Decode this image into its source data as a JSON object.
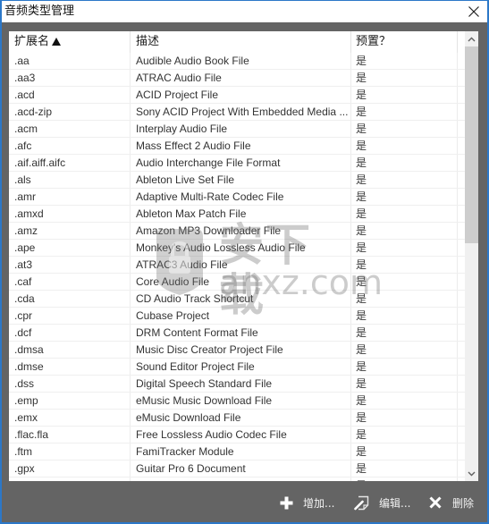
{
  "theme": {
    "accent": "#2c78c8",
    "panel": "#646464",
    "scroll_thumb": "#cdcdcd",
    "scroll_track": "#f0f0f0",
    "toolbar_text": "#f2f2f2"
  },
  "window": {
    "title": "音频类型管理",
    "close_icon": "close-icon"
  },
  "table": {
    "columns": [
      {
        "key": "ext",
        "label": "扩展名",
        "sort": "ascending",
        "sort_icon": "sort-ascending-icon"
      },
      {
        "key": "description",
        "label": "描述"
      },
      {
        "key": "preset",
        "label": "预置？"
      }
    ],
    "rows": [
      {
        "ext": ".aa",
        "description": "Audible Audio Book File",
        "preset": "是"
      },
      {
        "ext": ".aa3",
        "description": "ATRAC Audio File",
        "preset": "是"
      },
      {
        "ext": ".acd",
        "description": "ACID Project File",
        "preset": "是"
      },
      {
        "ext": ".acd-zip",
        "description": "Sony ACID Project With Embedded Media ...",
        "preset": "是"
      },
      {
        "ext": ".acm",
        "description": "Interplay Audio File",
        "preset": "是"
      },
      {
        "ext": ".afc",
        "description": "Mass Effect 2 Audio File",
        "preset": "是"
      },
      {
        "ext": ".aif.aiff.aifc",
        "description": "Audio Interchange File Format",
        "preset": "是"
      },
      {
        "ext": ".als",
        "description": "Ableton Live Set File",
        "preset": "是"
      },
      {
        "ext": ".amr",
        "description": "Adaptive Multi-Rate Codec File",
        "preset": "是"
      },
      {
        "ext": ".amxd",
        "description": "Ableton Max Patch File",
        "preset": "是"
      },
      {
        "ext": ".amz",
        "description": "Amazon MP3 Downloader File",
        "preset": "是"
      },
      {
        "ext": ".ape",
        "description": "Monkey's Audio Lossless Audio File",
        "preset": "是"
      },
      {
        "ext": ".at3",
        "description": "ATRAC3 Audio File",
        "preset": "是"
      },
      {
        "ext": ".caf",
        "description": "Core Audio File",
        "preset": "是"
      },
      {
        "ext": ".cda",
        "description": "CD Audio Track Shortcut",
        "preset": "是"
      },
      {
        "ext": ".cpr",
        "description": "Cubase Project",
        "preset": "是"
      },
      {
        "ext": ".dcf",
        "description": "DRM Content Format File",
        "preset": "是"
      },
      {
        "ext": ".dmsa",
        "description": "Music Disc Creator Project File",
        "preset": "是"
      },
      {
        "ext": ".dmse",
        "description": "Sound Editor Project File",
        "preset": "是"
      },
      {
        "ext": ".dss",
        "description": "Digital Speech Standard File",
        "preset": "是"
      },
      {
        "ext": ".emp",
        "description": "eMusic Music Download File",
        "preset": "是"
      },
      {
        "ext": ".emx",
        "description": "eMusic Download File",
        "preset": "是"
      },
      {
        "ext": ".flac.fla",
        "description": "Free Lossless Audio Codec File",
        "preset": "是"
      },
      {
        "ext": ".ftm",
        "description": "FamiTracker Module",
        "preset": "是"
      },
      {
        "ext": ".gpx",
        "description": "Guitar Pro 6 Document",
        "preset": "是"
      },
      {
        "preset": "是"
      }
    ]
  },
  "scrollbar": {
    "up_icon": "chevron-up-icon",
    "down_icon": "chevron-down-icon",
    "scroll_position": 0,
    "visible_fraction": 0.47
  },
  "toolbar": {
    "buttons": [
      {
        "label": "增加...",
        "icon": "plus-icon"
      },
      {
        "label": "编辑...",
        "icon": "edit-icon"
      },
      {
        "label": "删除",
        "icon": "delete-icon"
      }
    ]
  },
  "watermark": {
    "title": "安下载",
    "url": "anxz.com",
    "icon": "shield-lock-icon"
  }
}
